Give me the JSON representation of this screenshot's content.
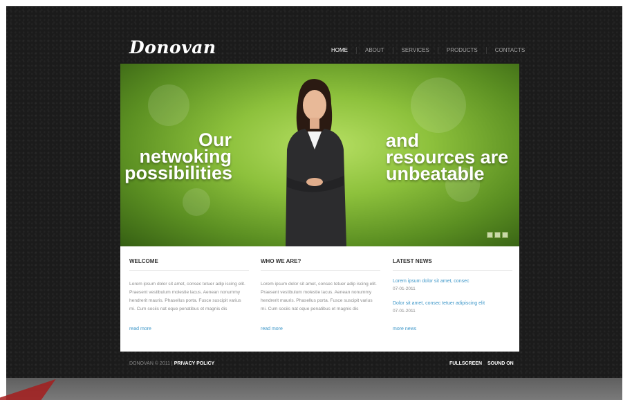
{
  "logo": "Donovan",
  "nav": [
    "HOME",
    "ABOUT",
    "SERVICES",
    "PRODUCTS",
    "CONTACTS"
  ],
  "hero": {
    "left_lines": [
      "Our",
      "netwoking",
      "possibilities"
    ],
    "right_lines": [
      "and",
      "resources are",
      "unbeatable"
    ]
  },
  "columns": {
    "welcome": {
      "title": "WELCOME",
      "text": "Lorem ipsum dolor sit amet, consec tetuer adip iscing elit. Praesent vestibulum molestie lacus. Aenean nonummy hendrerit mauris. Phasellus porta. Fusce suscipit varius mi. Cum sociis nat oque penatibus et magnis dis",
      "link": "read more"
    },
    "who": {
      "title": "WHO WE ARE?",
      "text": "Lorem ipsum dolor sit amet, consec tetuer adip iscing elit. Praesent vestibulum molestie lacus. Aenean nonummy hendrerit mauris. Phasellus porta. Fusce suscipit varius mi. Cum sociis nat oque penatibus et magnis dis",
      "link": "read more"
    },
    "news": {
      "title": "LATEST NEWS",
      "items": [
        {
          "title": "Lorem ipsum dolor sit amet, consec",
          "date": "07-01-2011"
        },
        {
          "title": "Dolor sit amet, consec tetuer adipiscing elit",
          "date": "07-01-2011"
        }
      ],
      "link": "more news"
    }
  },
  "footer": {
    "copyright": "DONOVAN © 2011 |",
    "policy": "PRIVACY POLICY",
    "fullscreen": "FULLSCREEN",
    "sound": "SOUND ON"
  },
  "colors": {
    "accent_link": "#3c96c8",
    "hero_green": "#8dc13c",
    "background": "#1b1b1b"
  }
}
